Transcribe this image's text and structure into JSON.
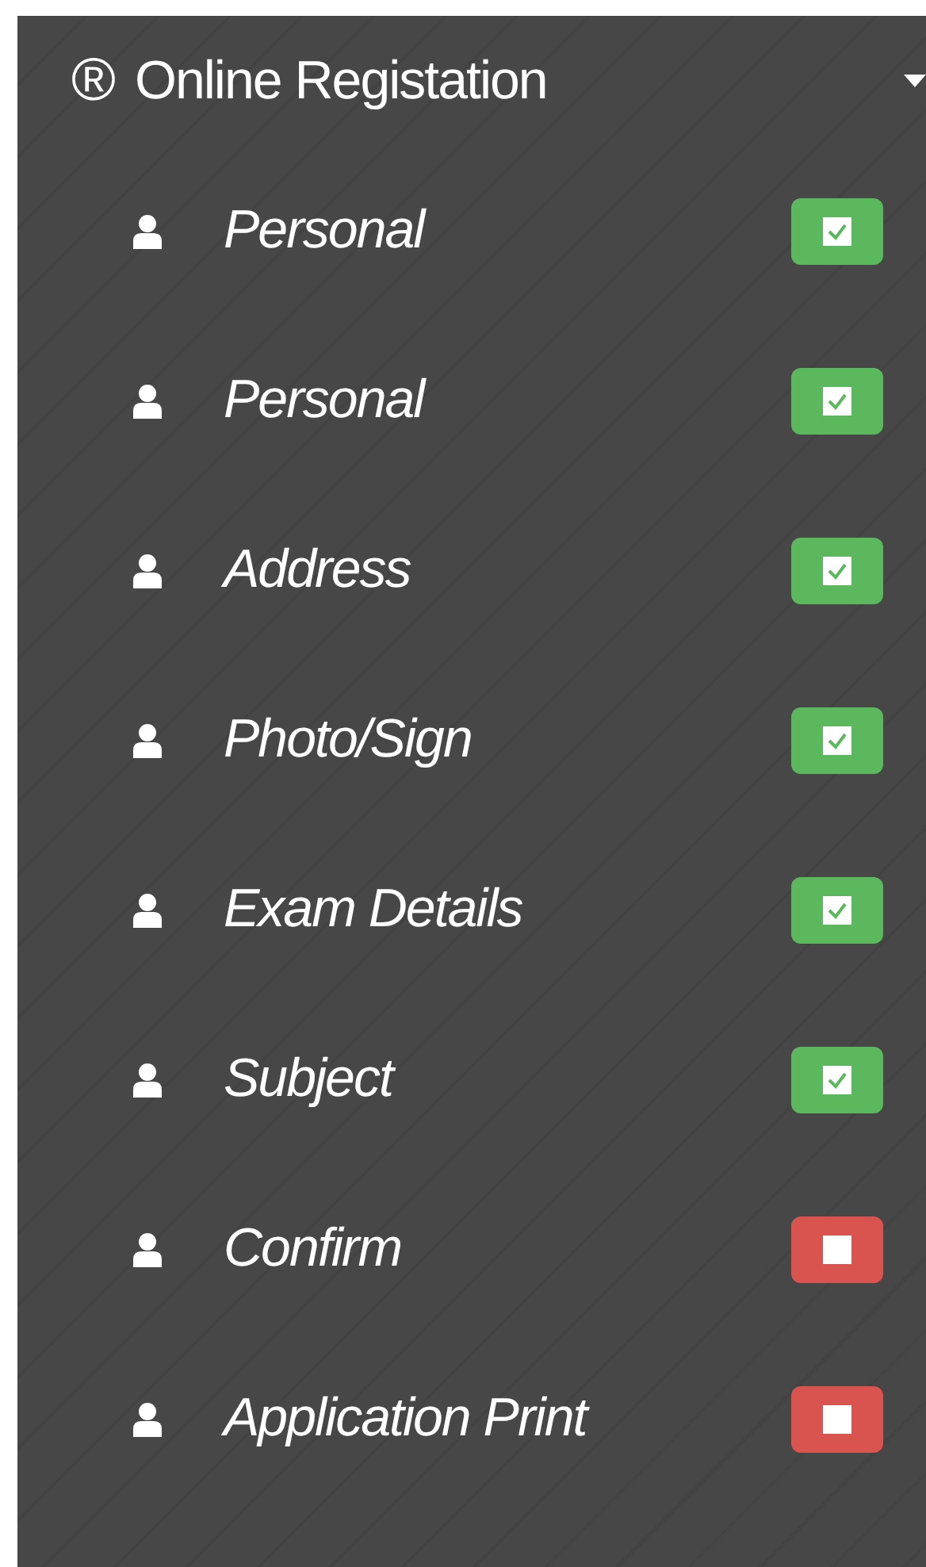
{
  "menu": {
    "icon": "®",
    "title": "Online Registation",
    "expanded": true,
    "items": [
      {
        "label": "Personal",
        "checked": true
      },
      {
        "label": "Personal",
        "checked": true
      },
      {
        "label": "Address",
        "checked": true
      },
      {
        "label": "Photo/Sign",
        "checked": true
      },
      {
        "label": "Exam Details",
        "checked": true
      },
      {
        "label": "Subject",
        "checked": true
      },
      {
        "label": "Confirm",
        "checked": false
      },
      {
        "label": "Application Print",
        "checked": false
      }
    ]
  }
}
